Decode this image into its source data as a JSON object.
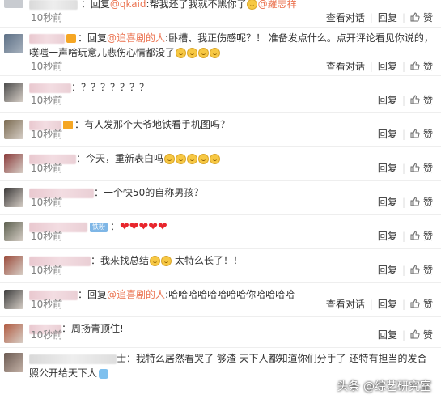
{
  "comments": [
    {
      "segments": [
        {
          "t": "回复",
          "c": "reply-word"
        },
        {
          "t": "@qkaid",
          "c": "link"
        },
        {
          "t": ":帮我还了我就不黑你了",
          "c": ""
        }
      ],
      "emoji_after": 1,
      "mention2": "@羅志祥",
      "time": "10秒前",
      "view": "查看对话",
      "reply": "回复",
      "like": "赞"
    },
    {
      "line1": [
        {
          "t": "回复",
          "c": "reply-word"
        },
        {
          "t": "@追喜剧的人",
          "c": "link"
        },
        {
          "t": ":卧槽、我正伤感呢？！ 准备发点什么。点开评论看见你说的，",
          "c": ""
        }
      ],
      "line2": "噗嗤一声啥玩意儿悲伤心情都没了",
      "time": "10秒前",
      "view": "查看对话",
      "reply": "回复",
      "like": "赞"
    },
    {
      "text": "：？？？？？？？",
      "time": "10秒前",
      "reply": "回复",
      "like": "赞"
    },
    {
      "text": "：有人发那个大爷地铁看手机图吗？",
      "time": "10秒前",
      "reply": "回复",
      "like": "赞"
    },
    {
      "text": "：今天，重新表白吗",
      "time": "10秒前",
      "reply": "回复",
      "like": "赞"
    },
    {
      "text": "：一个快50的自称男孩？",
      "time": "10秒前",
      "reply": "回复",
      "like": "赞"
    },
    {
      "badge": "铁粉",
      "time": "10秒前",
      "reply": "回复",
      "like": "赞"
    },
    {
      "text": "我来找总结",
      "text2": "太特么长了！！",
      "time": "10秒前",
      "reply": "回复",
      "like": "赞"
    },
    {
      "line1": [
        {
          "t": "：回复",
          "c": "reply-word"
        },
        {
          "t": "@追喜剧的人",
          "c": "link"
        },
        {
          "t": ":哈哈哈哈哈哈哈哈你哈哈哈哈",
          "c": ""
        }
      ],
      "time": "10秒前",
      "view": "查看对话",
      "reply": "回复",
      "like": "赞"
    },
    {
      "text": "周扬青顶住!",
      "time": "10秒前",
      "reply": "回复",
      "like": "赞"
    },
    {
      "text": "士：我特么居然看哭了  够渣  天下人都知道你们分手了 还特有担当的发合",
      "line2": "照公开给天下人"
    }
  ],
  "watermark": {
    "prefix": "头条",
    "name": "@综艺研究室"
  },
  "colors": {
    "link": "#eb7350",
    "meta": "#808080",
    "heart": "#e8262d"
  }
}
